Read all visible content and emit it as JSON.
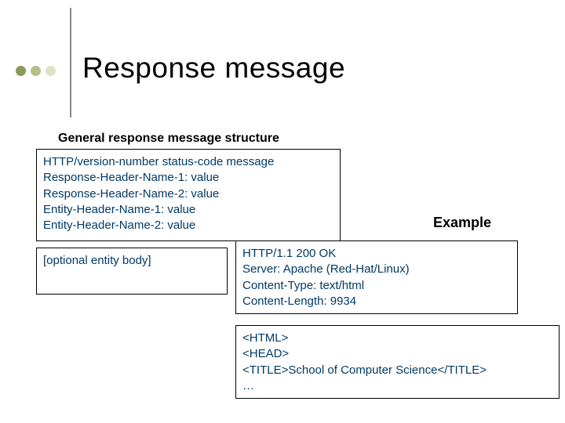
{
  "title": "Response message",
  "subhead": "General response message structure",
  "structure": {
    "line1": "HTTP/version-number  status-code  message",
    "line2": "Response-Header-Name-1: value",
    "line3": "Response-Header-Name-2: value",
    "line4": "Entity-Header-Name-1: value",
    "line5": "Entity-Header-Name-2: value"
  },
  "optional_body": "[optional entity body]",
  "example_label": "Example",
  "example_headers": {
    "line1": "HTTP/1.1  200  OK",
    "line2": "Server: Apache (Red-Hat/Linux)",
    "line3": "Content-Type: text/html",
    "line4": "Content-Length: 9934"
  },
  "example_body": {
    "line1": "<HTML>",
    "line2": "<HEAD>",
    "line3": "<TITLE>School of Computer Science</TITLE>",
    "line4": "…"
  }
}
